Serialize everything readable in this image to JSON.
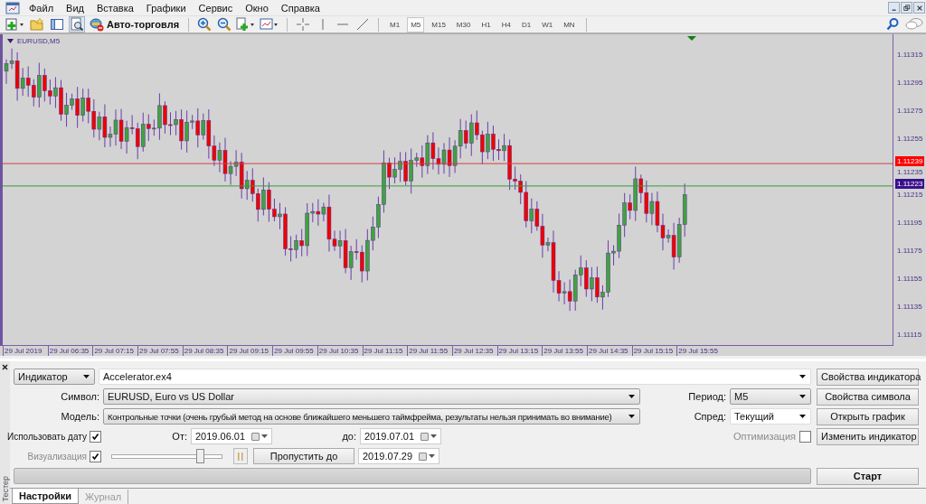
{
  "menu": [
    "Файл",
    "Вид",
    "Вставка",
    "Графики",
    "Сервис",
    "Окно",
    "Справка"
  ],
  "toolbar": {
    "autotrading_label": "Авто-торговля",
    "timeframes": [
      {
        "label": "M1",
        "selected": false
      },
      {
        "label": "M5",
        "selected": true
      },
      {
        "label": "M15",
        "selected": false
      },
      {
        "label": "M30",
        "selected": false
      },
      {
        "label": "H1",
        "selected": false
      },
      {
        "label": "H4",
        "selected": false
      },
      {
        "label": "D1",
        "selected": false
      },
      {
        "label": "W1",
        "selected": false
      },
      {
        "label": "MN",
        "selected": false
      }
    ]
  },
  "chart": {
    "symbol_label": "EURUSD,M5",
    "price_ticks": [
      "1.11315",
      "1.11295",
      "1.11275",
      "1.11255",
      "1.11235",
      "1.11215",
      "1.11195",
      "1.11175",
      "1.11155",
      "1.11135",
      "1.11115"
    ],
    "price_lines": [
      {
        "kind": "ask",
        "label": "1.11239"
      },
      {
        "kind": "bid",
        "label": "1.11223"
      }
    ],
    "time_ticks": [
      "29 Jul 2019",
      "29 Jul 06:35",
      "29 Jul 07:15",
      "29 Jul 07:55",
      "29 Jul 08:35",
      "29 Jul 09:15",
      "29 Jul 09:55",
      "29 Jul 10:35",
      "29 Jul 11:15",
      "29 Jul 11:55",
      "29 Jul 12:35",
      "29 Jul 13:15",
      "29 Jul 13:55",
      "29 Jul 14:35",
      "29 Jul 15:15",
      "29 Jul 15:55"
    ]
  },
  "tester": {
    "panel_title": "Тестер",
    "mode": "Индикатор",
    "program": "Accelerator.ex4",
    "symbol": {
      "label": "Символ:",
      "value": "EURUSD, Euro vs US Dollar"
    },
    "model": {
      "label": "Модель:",
      "value": "Контрольные точки (очень грубый метод на основе ближайшего меньшего таймфрейма, результаты нельзя принимать во внимание)"
    },
    "period": {
      "label": "Период:",
      "value": "M5"
    },
    "spread": {
      "label": "Спред:",
      "value": "Текущий"
    },
    "use_date": {
      "label": "Использовать дату",
      "checked": true
    },
    "from": {
      "label": "От:",
      "value": "2019.06.01"
    },
    "to": {
      "label": "до:",
      "value": "2019.07.01"
    },
    "optimization": {
      "label": "Оптимизация",
      "checked": false
    },
    "visualization": {
      "label": "Визуализация",
      "checked": true,
      "speed": {
        "level": 0.8
      }
    },
    "skip_button": "Пропустить до",
    "skip_date": "2019.07.29",
    "progress": {
      "level": 0
    },
    "buttons": [
      {
        "label": "Свойства индикатора",
        "default": false
      },
      {
        "label": "Свойства символа",
        "default": false
      },
      {
        "label": "Открыть график",
        "default": false
      },
      {
        "label": "Изменить индикатор",
        "default": false
      },
      {
        "label": "Старт",
        "default": true
      }
    ],
    "tabs": [
      {
        "label": "Настройки",
        "selected": true
      },
      {
        "label": "Журнал",
        "selected": false
      }
    ]
  }
}
